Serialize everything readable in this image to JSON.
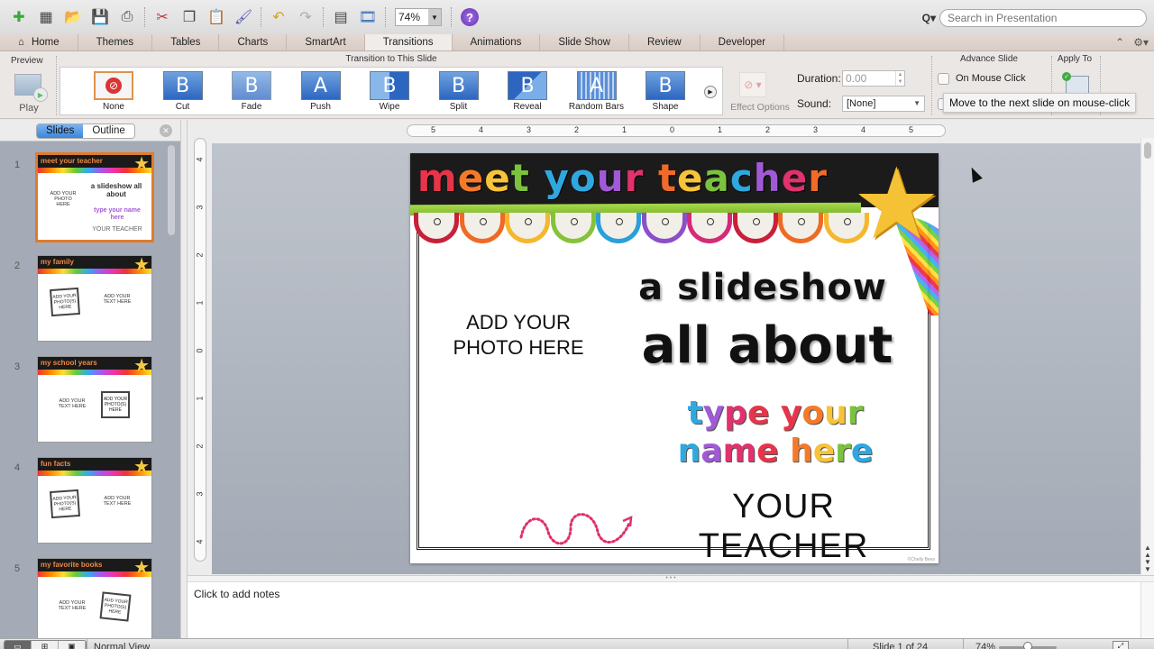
{
  "toolbar": {
    "icons": [
      "new-presentation-icon",
      "gallery-icon",
      "open-icon",
      "save-icon",
      "print-icon",
      "cut-icon",
      "copy-icon",
      "paste-icon",
      "format-painter-icon",
      "undo-icon",
      "redo-icon",
      "slide-layout-icon",
      "media-icon"
    ],
    "zoom_value": "74%",
    "help_label": "?",
    "search_placeholder": "Search in Presentation"
  },
  "tabs": {
    "items": [
      {
        "label": "Home",
        "active": false
      },
      {
        "label": "Themes",
        "active": false
      },
      {
        "label": "Tables",
        "active": false
      },
      {
        "label": "Charts",
        "active": false
      },
      {
        "label": "SmartArt",
        "active": false
      },
      {
        "label": "Transitions",
        "active": true
      },
      {
        "label": "Animations",
        "active": false
      },
      {
        "label": "Slide Show",
        "active": false
      },
      {
        "label": "Review",
        "active": false
      },
      {
        "label": "Developer",
        "active": false
      }
    ],
    "home_glyph": "⌂"
  },
  "ribbon": {
    "preview_group": "Preview",
    "play_label": "Play",
    "transition_group": "Transition to This Slide",
    "transitions": [
      {
        "label": "None",
        "glyph": "⊘",
        "selected": true
      },
      {
        "label": "Cut",
        "glyph": "B"
      },
      {
        "label": "Fade",
        "glyph": "B"
      },
      {
        "label": "Push",
        "glyph": "A"
      },
      {
        "label": "Wipe",
        "glyph": "B"
      },
      {
        "label": "Split",
        "glyph": "B"
      },
      {
        "label": "Reveal",
        "glyph": "B"
      },
      {
        "label": "Random Bars",
        "glyph": "A"
      },
      {
        "label": "Shape",
        "glyph": "B"
      }
    ],
    "effect_options_label": "Effect Options",
    "duration_label": "Duration:",
    "duration_value": "0.00",
    "sound_label": "Sound:",
    "sound_value": "[None]",
    "advance_group": "Advance Slide",
    "on_mouse_click_label": "On Mouse Click",
    "on_mouse_click_checked": false,
    "apply_to_group": "Apply To",
    "tooltip": "Move to the next slide on mouse-click"
  },
  "left_panel": {
    "tab_slides": "Slides",
    "tab_outline": "Outline",
    "slides": [
      {
        "number": "1",
        "title": "meet your teacher",
        "selected": true,
        "lines": [
          "ADD YOUR PHOTO HERE",
          "a slideshow all about",
          "type your name here",
          "YOUR TEACHER"
        ]
      },
      {
        "number": "2",
        "title": "my family",
        "left_box": "ADD YOUR PHOTO(S) HERE",
        "right_text": "ADD YOUR TEXT HERE"
      },
      {
        "number": "3",
        "title": "my school years",
        "left_text": "ADD YOUR TEXT HERE",
        "right_box": "ADD YOUR PHOTO(S) HERE"
      },
      {
        "number": "4",
        "title": "fun facts",
        "left_box": "ADD YOUR PHOTO(S) HERE",
        "right_text": "ADD YOUR TEXT HERE"
      },
      {
        "number": "5",
        "title": "my favorite books",
        "left_text": "ADD YOUR TEXT HERE",
        "right_box": "ADD YOUR PHOTO(S) HERE"
      }
    ]
  },
  "rulers": {
    "horizontal": [
      "5",
      "4",
      "3",
      "2",
      "1",
      "0",
      "1",
      "2",
      "3",
      "4",
      "5"
    ],
    "vertical": [
      "4",
      "3",
      "2",
      "1",
      "0",
      "1",
      "2",
      "3",
      "4"
    ]
  },
  "slide": {
    "title_words": [
      {
        "text": "m",
        "color": "#e8344a"
      },
      {
        "text": "e",
        "color": "#f47a2a"
      },
      {
        "text": "e",
        "color": "#f6c33a"
      },
      {
        "text": "t",
        "color": "#7bc23f"
      },
      {
        "text": " ",
        "color": "#fff"
      },
      {
        "text": "y",
        "color": "#2fa8e0"
      },
      {
        "text": "o",
        "color": "#2fa8e0"
      },
      {
        "text": "u",
        "color": "#a15ad6"
      },
      {
        "text": "r",
        "color": "#e0326e"
      },
      {
        "text": " ",
        "color": "#fff"
      },
      {
        "text": "t",
        "color": "#f06a2a"
      },
      {
        "text": "e",
        "color": "#f6c33a"
      },
      {
        "text": "a",
        "color": "#7bc23f"
      },
      {
        "text": "c",
        "color": "#2fa8e0"
      },
      {
        "text": "h",
        "color": "#a15ad6"
      },
      {
        "text": "e",
        "color": "#e0326e"
      },
      {
        "text": "r",
        "color": "#f06a2a"
      }
    ],
    "photo_placeholder": "ADD YOUR PHOTO HERE",
    "subtitle_line1": "a slideshow",
    "subtitle_line2": "all about",
    "name_line1": [
      {
        "text": "t",
        "color": "#2fa8e0"
      },
      {
        "text": "y",
        "color": "#a15ad6"
      },
      {
        "text": "p",
        "color": "#e0326e"
      },
      {
        "text": "e",
        "color": "#e8344a"
      },
      {
        "text": " ",
        "color": "#fff"
      },
      {
        "text": "y",
        "color": "#e8344a"
      },
      {
        "text": "o",
        "color": "#f47a2a"
      },
      {
        "text": "u",
        "color": "#f6c33a"
      },
      {
        "text": "r",
        "color": "#7bc23f"
      }
    ],
    "name_line2": [
      {
        "text": "n",
        "color": "#2fa8e0"
      },
      {
        "text": "a",
        "color": "#a15ad6"
      },
      {
        "text": "m",
        "color": "#e0326e"
      },
      {
        "text": "e",
        "color": "#e8344a"
      },
      {
        "text": " ",
        "color": "#fff"
      },
      {
        "text": "h",
        "color": "#f47a2a"
      },
      {
        "text": "e",
        "color": "#f6c33a"
      },
      {
        "text": "r",
        "color": "#7bc23f"
      },
      {
        "text": "e",
        "color": "#2fa8e0"
      }
    ],
    "teacher_label": "YOUR TEACHER",
    "scallop_colors": [
      "#c8203a",
      "#ee6a25",
      "#f4b72d",
      "#86c23a",
      "#2a9fd8",
      "#8d4fc8",
      "#d42a78",
      "#c8203a",
      "#ee6a25",
      "#f4b72d"
    ],
    "copyright": "©Chelly Bees"
  },
  "notes": {
    "placeholder": "Click to add notes"
  },
  "status": {
    "view": "Normal View",
    "slide_position": "Slide 1 of 24",
    "zoom": "74%"
  }
}
